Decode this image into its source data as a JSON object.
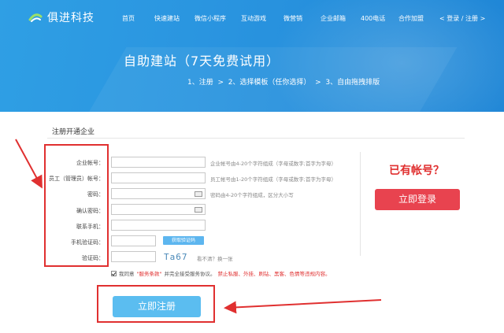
{
  "header": {
    "logo_text": "俱进科技",
    "nav": [
      "首页",
      "快速建站",
      "微信小程序",
      "互动游戏",
      "微营销",
      "企业邮箱",
      "400电话",
      "合作加盟"
    ],
    "auth_link": "< 登录 / 注册 >"
  },
  "hero": {
    "title": "自助建站（7天免费试用）",
    "steps": "1、注册  >  2、选择模板（任你选择）  >  3、自由拖拽排版"
  },
  "form": {
    "section_title": "注册开通企业",
    "fields": [
      {
        "label": "企业帐号：",
        "hint": "企业帐号由4-20个字符组成（字母或数字;首字为字母）"
      },
      {
        "label": "员工（管理员）帐号：",
        "hint": "员工帐号由1-20个字符组成（字母或数字;首字为字母）"
      },
      {
        "label": "密码：",
        "hint": "密码由4-20个字符组成，区分大小写"
      },
      {
        "label": "确认密码：",
        "hint": ""
      },
      {
        "label": "联系手机：",
        "hint": ""
      },
      {
        "label": "手机验证码：",
        "hint": ""
      },
      {
        "label": "验证码：",
        "hint": ""
      }
    ],
    "sms_button": "获取验证码",
    "captcha_text": "Ta67",
    "captcha_hint": "看不清？换一张",
    "agree_prefix": "我同意",
    "agree_terms": "\"服务条款\"",
    "agree_middle": "并完全接受服务协议。",
    "agree_warning": "禁止私服、外挂、刷钻、黑客、色情等违规内容。",
    "submit_label": "立即注册"
  },
  "side": {
    "have_account": "已有帐号？",
    "login_label": "立即登录"
  },
  "colors": {
    "banner": "#2a95e0",
    "accent_blue": "#5bbdf0",
    "accent_red": "#e8434f",
    "annotation_red": "#e03030"
  }
}
